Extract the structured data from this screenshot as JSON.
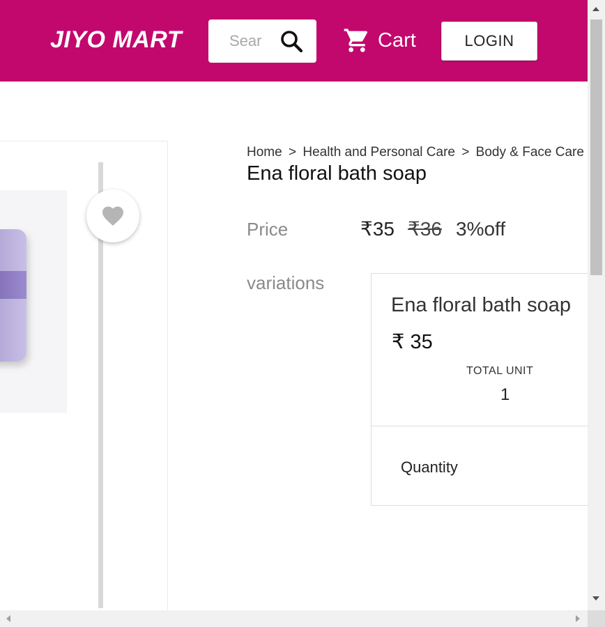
{
  "header": {
    "brand": "JIYO MART",
    "search_placeholder": "Search",
    "cart_label": "Cart",
    "login_label": "LOGIN",
    "background_color": "#c2086d"
  },
  "breadcrumb": {
    "items": [
      "Home",
      "Health and Personal Care",
      "Body & Face Care"
    ],
    "separator": ">"
  },
  "product": {
    "title": "Ena floral bath soap",
    "price_label": "Price",
    "price": "₹35",
    "mrp": "₹36",
    "discount": "3%off",
    "variations_label": "variations",
    "variation": {
      "name": "Ena floral bath soap",
      "price": "₹ 35",
      "total_unit_label": "TOTAL UNIT",
      "total_unit_value": "1",
      "quantity_label": "Quantity"
    },
    "wishlist_icon": "heart-icon"
  },
  "icons": {
    "search": "search-icon",
    "cart": "cart-icon"
  }
}
